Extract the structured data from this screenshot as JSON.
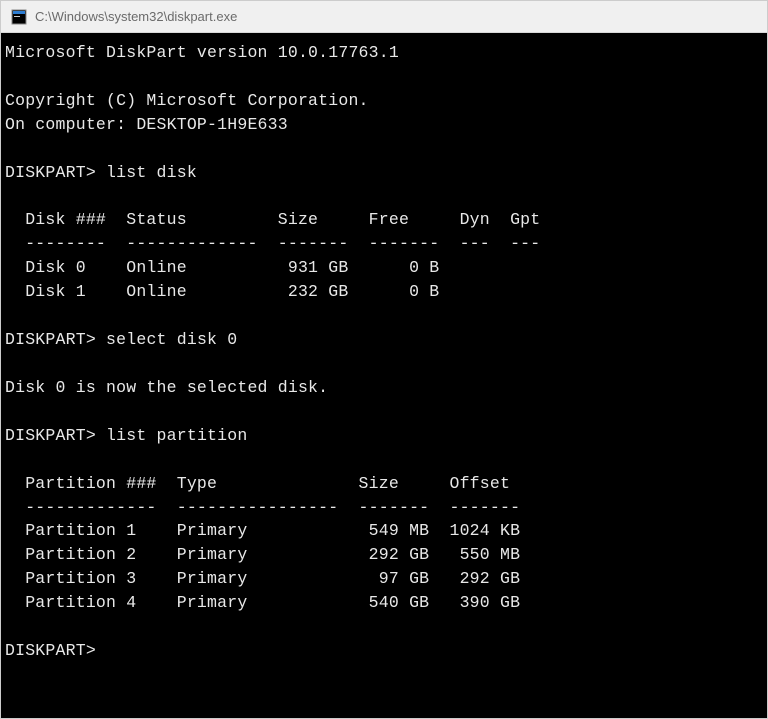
{
  "window": {
    "title": "C:\\Windows\\system32\\diskpart.exe"
  },
  "header": {
    "version_line": "Microsoft DiskPart version 10.0.17763.1",
    "copyright": "Copyright (C) Microsoft Corporation.",
    "computer": "On computer: DESKTOP-1H9E633"
  },
  "sessions": [
    {
      "prompt": "DISKPART>",
      "command": "list disk",
      "output": {
        "type": "table",
        "header": "  Disk ###  Status         Size     Free     Dyn  Gpt",
        "divider": "  --------  -------------  -------  -------  ---  ---",
        "rows": [
          "  Disk 0    Online          931 GB      0 B",
          "  Disk 1    Online          232 GB      0 B"
        ]
      }
    },
    {
      "prompt": "DISKPART>",
      "command": "select disk 0",
      "output": {
        "type": "message",
        "text": "Disk 0 is now the selected disk."
      }
    },
    {
      "prompt": "DISKPART>",
      "command": "list partition",
      "output": {
        "type": "table",
        "header": "  Partition ###  Type              Size     Offset",
        "divider": "  -------------  ----------------  -------  -------",
        "rows": [
          "  Partition 1    Primary            549 MB  1024 KB",
          "  Partition 2    Primary            292 GB   550 MB",
          "  Partition 3    Primary             97 GB   292 GB",
          "  Partition 4    Primary            540 GB   390 GB"
        ]
      }
    }
  ],
  "current_prompt": "DISKPART>",
  "disks_data": [
    {
      "id": "Disk 0",
      "status": "Online",
      "size": "931 GB",
      "free": "0 B",
      "dyn": "",
      "gpt": ""
    },
    {
      "id": "Disk 1",
      "status": "Online",
      "size": "232 GB",
      "free": "0 B",
      "dyn": "",
      "gpt": ""
    }
  ],
  "partitions_data": [
    {
      "id": "Partition 1",
      "type": "Primary",
      "size": "549 MB",
      "offset": "1024 KB"
    },
    {
      "id": "Partition 2",
      "type": "Primary",
      "size": "292 GB",
      "offset": "550 MB"
    },
    {
      "id": "Partition 3",
      "type": "Primary",
      "size": "97 GB",
      "offset": "292 GB"
    },
    {
      "id": "Partition 4",
      "type": "Primary",
      "size": "540 GB",
      "offset": "390 GB"
    }
  ]
}
